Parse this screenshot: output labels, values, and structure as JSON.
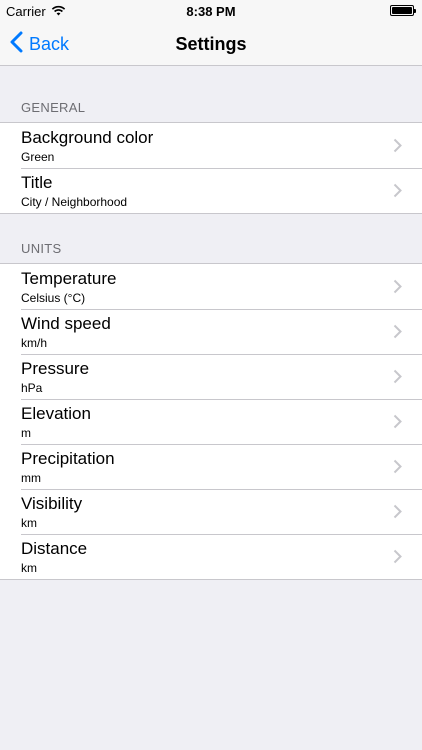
{
  "status_bar": {
    "carrier": "Carrier",
    "time": "8:38 PM",
    "battery_level": 1.0
  },
  "nav": {
    "back_label": "Back",
    "title": "Settings"
  },
  "sections": {
    "general": {
      "header": "GENERAL",
      "rows": [
        {
          "title": "Background color",
          "value": "Green"
        },
        {
          "title": "Title",
          "value": "City / Neighborhood"
        }
      ]
    },
    "units": {
      "header": "UNITS",
      "rows": [
        {
          "title": "Temperature",
          "value": "Celsius (°C)"
        },
        {
          "title": "Wind speed",
          "value": "km/h"
        },
        {
          "title": "Pressure",
          "value": "hPa"
        },
        {
          "title": "Elevation",
          "value": "m"
        },
        {
          "title": "Precipitation",
          "value": "mm"
        },
        {
          "title": "Visibility",
          "value": "km"
        },
        {
          "title": "Distance",
          "value": "km"
        }
      ]
    }
  },
  "icons": {
    "wifi": "wifi-icon",
    "battery": "battery-icon",
    "back": "chevron-left-icon",
    "disclosure": "chevron-right-icon"
  },
  "colors": {
    "accent": "#007aff",
    "background": "#efeff4",
    "chevron": "#c7c7cc"
  }
}
